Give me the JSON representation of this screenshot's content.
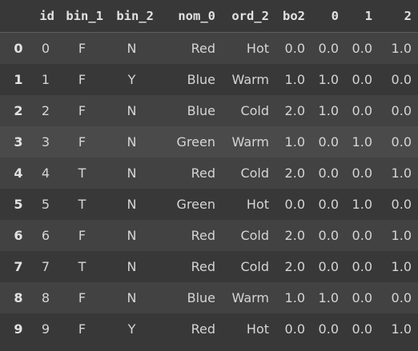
{
  "columns": [
    "",
    "id",
    "bin_1",
    "bin_2",
    "nom_0",
    "ord_2",
    "bo2",
    "0",
    "1",
    "2"
  ],
  "rows": [
    {
      "index": "0",
      "cells": [
        "0",
        "F",
        "N",
        "Red",
        "Hot",
        "0.0",
        "0.0",
        "0.0",
        "1.0"
      ]
    },
    {
      "index": "1",
      "cells": [
        "1",
        "F",
        "Y",
        "Blue",
        "Warm",
        "1.0",
        "1.0",
        "0.0",
        "0.0"
      ]
    },
    {
      "index": "2",
      "cells": [
        "2",
        "F",
        "N",
        "Blue",
        "Cold",
        "2.0",
        "1.0",
        "0.0",
        "0.0"
      ]
    },
    {
      "index": "3",
      "cells": [
        "3",
        "F",
        "N",
        "Green",
        "Warm",
        "1.0",
        "0.0",
        "1.0",
        "0.0"
      ]
    },
    {
      "index": "4",
      "cells": [
        "4",
        "T",
        "N",
        "Red",
        "Cold",
        "2.0",
        "0.0",
        "0.0",
        "1.0"
      ]
    },
    {
      "index": "5",
      "cells": [
        "5",
        "T",
        "N",
        "Green",
        "Hot",
        "0.0",
        "0.0",
        "1.0",
        "0.0"
      ]
    },
    {
      "index": "6",
      "cells": [
        "6",
        "F",
        "N",
        "Red",
        "Cold",
        "2.0",
        "0.0",
        "0.0",
        "1.0"
      ]
    },
    {
      "index": "7",
      "cells": [
        "7",
        "T",
        "N",
        "Red",
        "Cold",
        "2.0",
        "0.0",
        "0.0",
        "1.0"
      ]
    },
    {
      "index": "8",
      "cells": [
        "8",
        "F",
        "N",
        "Blue",
        "Warm",
        "1.0",
        "1.0",
        "0.0",
        "0.0"
      ]
    },
    {
      "index": "9",
      "cells": [
        "9",
        "F",
        "Y",
        "Red",
        "Hot",
        "0.0",
        "0.0",
        "0.0",
        "1.0"
      ]
    }
  ],
  "highlighted_row_index": "3",
  "colors": {
    "background": "#383838",
    "row_alt": "#424242",
    "row_highlight": "#4a4a4a",
    "text": "#d5d5d5",
    "header_text": "#e2e2e2"
  }
}
